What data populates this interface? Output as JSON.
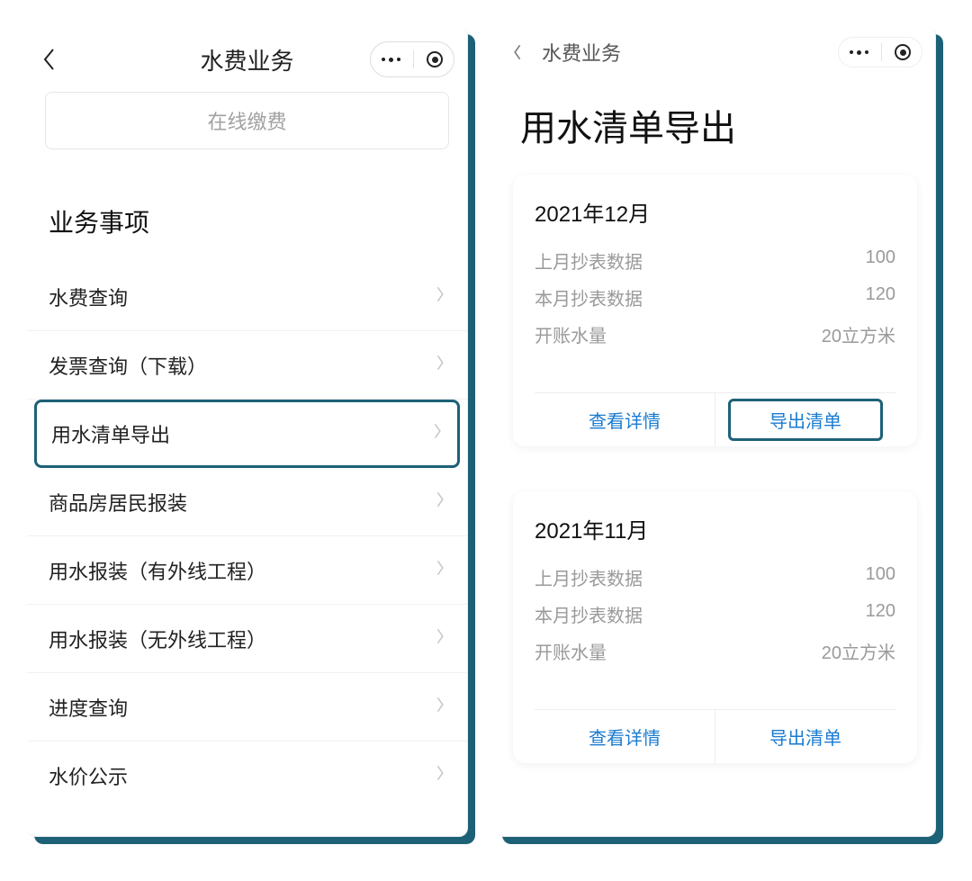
{
  "screen_left": {
    "header": {
      "title": "水费业务"
    },
    "pay_button_label": "在线缴费",
    "section_title": "业务事项",
    "items": [
      {
        "label": "水费查询"
      },
      {
        "label": "发票查询（下载）"
      },
      {
        "label": "用水清单导出"
      },
      {
        "label": "商品房居民报装"
      },
      {
        "label": "用水报装（有外线工程）"
      },
      {
        "label": "用水报装（无外线工程）"
      },
      {
        "label": "进度查询"
      },
      {
        "label": "水价公示"
      }
    ],
    "highlight_index": 2
  },
  "screen_right": {
    "header": {
      "title": "水费业务"
    },
    "page_title": "用水清单导出",
    "labels": {
      "prev_month_meter": "上月抄表数据",
      "this_month_meter": "本月抄表数据",
      "billed_amount": "开账水量",
      "view_details": "查看详情",
      "export_list": "导出清单"
    },
    "unit": "立方米",
    "cards": [
      {
        "title": "2021年12月",
        "prev": "100",
        "current": "120",
        "billed": "20"
      },
      {
        "title": "2021年11月",
        "prev": "100",
        "current": "120",
        "billed": "20"
      }
    ],
    "highlight_card_index": 0
  },
  "colors": {
    "accent_teal": "#1d6177",
    "link_blue": "#197bd1"
  }
}
